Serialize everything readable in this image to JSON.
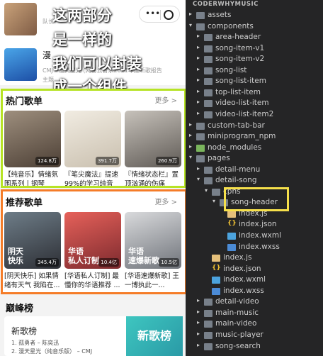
{
  "annotation": [
    "这两部分",
    "是一样的",
    "我们可以封装",
    "成一个组件"
  ],
  "top_list": [
    {
      "title": "",
      "line2": "队长",
      "line3": ""
    },
    {
      "title": "漫",
      "line2": "CMJ - 漫天星光 (网易云音乐2021年度听歌报告",
      "line3": "主题"
    }
  ],
  "hot_section": {
    "title": "热门歌单",
    "more": "更多 >",
    "cards": [
      {
        "count": "124.8万",
        "name": "【纯音乐】情绪氛围系列丨钢琴"
      },
      {
        "count": "391.7万",
        "name": "『笔尖魔法』提速99%的学习纯音"
      },
      {
        "count": "260.9万",
        "name": "『情绪状态栏』置顶汹涌的伤痛"
      }
    ]
  },
  "rec_section": {
    "title": "推荐歌单",
    "more": "更多 >",
    "cards": [
      {
        "count": "345.4万",
        "cover_text": "阴天\n快乐",
        "name": "[阴天快乐] 如果情绪有天气 我陷在..."
      },
      {
        "count": "10.4亿",
        "cover_text": "华语\n私人订制",
        "name": "[华语私人订制] 最懂你的华语推荐 ..."
      },
      {
        "count": "10.5亿",
        "cover_text": "华语\n速爆新歌",
        "name": "[华语速爆新歌] 王一博执此一..."
      }
    ]
  },
  "rank": {
    "title": "巅峰榜",
    "card_title": "新歌榜",
    "line1": "1. 孤勇者 – 陈奕迅",
    "line2": "2. 漫天星光（纯音乐版） – CMJ",
    "image_text": "新歌榜"
  },
  "explorer": {
    "project": "CODERWHYMUSIC",
    "rows": [
      {
        "depth": 1,
        "type": "folder",
        "open": false,
        "label": "assets"
      },
      {
        "depth": 1,
        "type": "folder",
        "open": true,
        "label": "components"
      },
      {
        "depth": 2,
        "type": "folder",
        "open": false,
        "label": "area-header"
      },
      {
        "depth": 2,
        "type": "folder",
        "open": false,
        "label": "song-item-v1"
      },
      {
        "depth": 2,
        "type": "folder",
        "open": false,
        "label": "song-item-v2"
      },
      {
        "depth": 2,
        "type": "folder",
        "open": false,
        "label": "song-list"
      },
      {
        "depth": 2,
        "type": "folder",
        "open": false,
        "label": "song-list-item"
      },
      {
        "depth": 2,
        "type": "folder",
        "open": false,
        "label": "top-list-item"
      },
      {
        "depth": 2,
        "type": "folder",
        "open": false,
        "label": "video-list-item"
      },
      {
        "depth": 2,
        "type": "folder",
        "open": false,
        "label": "video-list-item2"
      },
      {
        "depth": 1,
        "type": "folder",
        "open": false,
        "label": "custom-tab-bar"
      },
      {
        "depth": 1,
        "type": "folder",
        "open": false,
        "label": "miniprogram_npm"
      },
      {
        "depth": 1,
        "type": "folder-green",
        "open": false,
        "label": "node_modules"
      },
      {
        "depth": 1,
        "type": "folder",
        "open": true,
        "label": "pages"
      },
      {
        "depth": 2,
        "type": "folder",
        "open": false,
        "label": "detail-menu"
      },
      {
        "depth": 2,
        "type": "folder",
        "open": true,
        "label": "detail-song"
      },
      {
        "depth": 3,
        "type": "folder",
        "open": true,
        "label": "cpns"
      },
      {
        "depth": 4,
        "type": "folder",
        "open": true,
        "label": "song-header"
      },
      {
        "depth": 5,
        "type": "js",
        "label": "index.js"
      },
      {
        "depth": 5,
        "type": "json",
        "label": "index.json"
      },
      {
        "depth": 5,
        "type": "wxml",
        "label": "index.wxml"
      },
      {
        "depth": 5,
        "type": "wxss",
        "label": "index.wxss"
      },
      {
        "depth": 3,
        "type": "js",
        "label": "index.js"
      },
      {
        "depth": 3,
        "type": "json",
        "label": "index.json"
      },
      {
        "depth": 3,
        "type": "wxml",
        "label": "index.wxml"
      },
      {
        "depth": 3,
        "type": "wxss",
        "label": "index.wxss"
      },
      {
        "depth": 2,
        "type": "folder",
        "open": false,
        "label": "detail-video"
      },
      {
        "depth": 2,
        "type": "folder",
        "open": false,
        "label": "main-music"
      },
      {
        "depth": 2,
        "type": "folder",
        "open": false,
        "label": "main-video"
      },
      {
        "depth": 2,
        "type": "folder",
        "open": false,
        "label": "music-player"
      },
      {
        "depth": 2,
        "type": "folder",
        "open": false,
        "label": "song-search"
      }
    ]
  },
  "colors": {
    "green_box": "#b6e325",
    "orange_box": "#f57c28",
    "yellow_box": "#f6e04b"
  }
}
